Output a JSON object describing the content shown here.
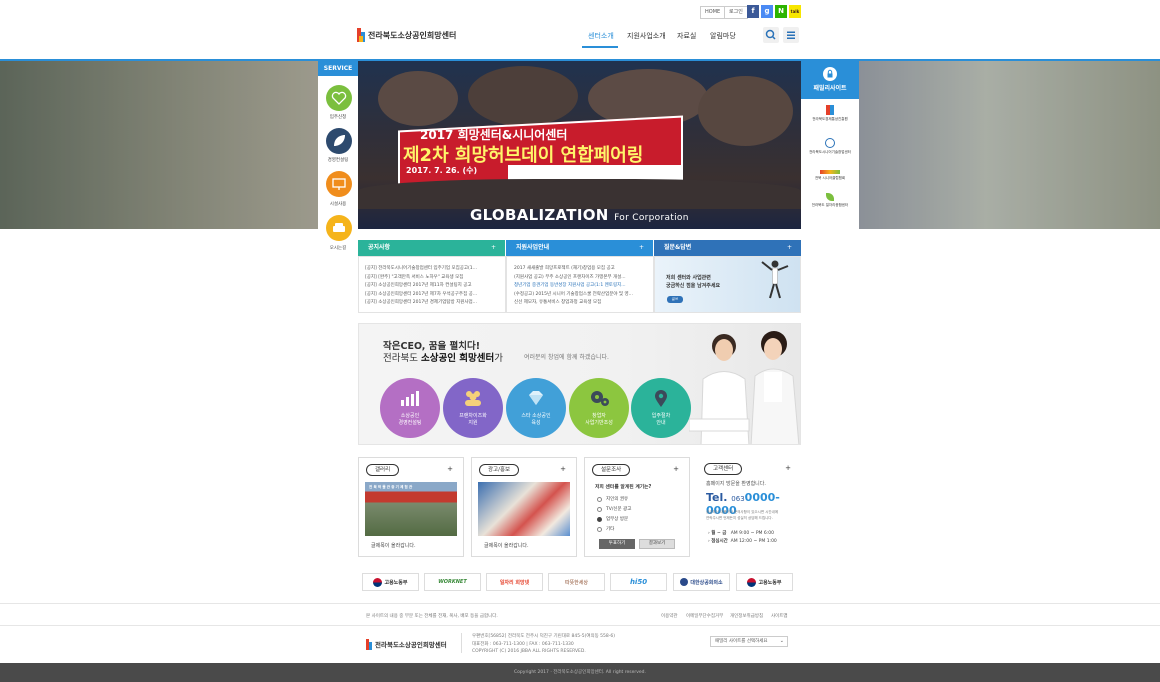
{
  "top_utility": {
    "home": "HOME",
    "login": "로그인",
    "sns": [
      "f",
      "g",
      "N",
      "talk"
    ]
  },
  "header": {
    "logo_text": "전라북도소상공인희망센터",
    "nav": [
      "센터소개",
      "지원사업소개",
      "자료실",
      "알림마당"
    ]
  },
  "hero": {
    "banner_line1": "2017 희망센터&시니어센터",
    "banner_line2": "제2차 희망허브데이 연합페어링",
    "banner_date": "2017. 7. 26. (수)",
    "slogan_main": "GLOBALIZATION",
    "slogan_sub": "For Corporation"
  },
  "service": {
    "title": "SERVICE",
    "items": [
      {
        "label": "입주신청",
        "color": "#7bbf3e"
      },
      {
        "label": "경영컨설팅",
        "color": "#2d4a6e"
      },
      {
        "label": "시설사용",
        "color": "#f08d1c"
      },
      {
        "label": "오시는길",
        "color": "#f5b41b"
      }
    ]
  },
  "family": {
    "title": "패밀리사이트",
    "sites": [
      "전라북도경제통상진흥원",
      "전라북도시니어기술창업센터",
      "전북 시니어클럽협회",
      "전라북도 일자리종합센터"
    ]
  },
  "boards": [
    {
      "title": "공지사항",
      "plus": "+",
      "color": "#2bb39a",
      "items": [
        "[공지] 전라북도시니어기술창업센터 입주기업 모집공고(1...",
        "[공지] [완주] \"고객만족 서비스 노하우\" 교육생 모집",
        "[공지] 소상공인희망센터 2017년 제11차 컨설팅지 공고",
        "[공지] 소상공인희망센터 2017년 제7차 우석공구주집 공...",
        "[공지] 소상공인희망센터 2017년 경제기업탐방 지원사업..."
      ]
    },
    {
      "title": "지원사업안내",
      "plus": "+",
      "color": "#2a8fd8",
      "items": [
        "2017 새새출발 희망프로젝트 (재기)창업용 모집 공고",
        "(지원사업 공고) 무주 소상공인 프랜차이즈 가맹본부 개설...",
        "청년기업 중견기업 동반성장 지원사업 공고(1:1 멘토링지...",
        "(수정공고) 2015년 시니어 기술창업스쿨 전략산업분야 및 영...",
        "신선 제모자, 유통서비스 창업과정 교육생 모집"
      ]
    },
    {
      "title": "질문&답변",
      "plus": "+",
      "color": "#2f72b8",
      "promo_line1": "저희 센터와 사업관련",
      "promo_line2": "궁금하신 점을 남겨주세요",
      "promo_button": "글쓰"
    }
  ],
  "ceo": {
    "line1": "작은CEO, 꿈을 펼치다!",
    "line2_prefix": "전라북도 ",
    "line2_bold": "소상공인 희망센터",
    "line2_suffix": "가",
    "line3": "여러분의 창업에 함께 하겠습니다.",
    "circles": [
      {
        "line1": "소상공인",
        "line2": "경영컨설팅",
        "color": "#b46fc4"
      },
      {
        "line1": "프랜차이즈화",
        "line2": "지원",
        "color": "#8266c8"
      },
      {
        "line1": "스타 소상공인",
        "line2": "육성",
        "color": "#41a0d8"
      },
      {
        "line1": "창업자",
        "line2": "사업기반조성",
        "color": "#8cc63f"
      },
      {
        "line1": "입주절차",
        "line2": "안내",
        "color": "#2bb39a"
      }
    ]
  },
  "widgets": {
    "gallery": {
      "title": "갤러리",
      "plus": "+",
      "caption": "글제목이 올라갑니다.",
      "photo_sign": "전 북 박 물 관   중 기 체 험 관"
    },
    "ad": {
      "title": "광고/홍보",
      "plus": "+",
      "caption": "글제목이 올라갑니다."
    },
    "survey": {
      "title": "설문조사",
      "plus": "+",
      "question": "저희 센터를 알게된 계기는?",
      "options": [
        "지인의 권유",
        "TV/신문 광고",
        "업무상 방문",
        "기타"
      ],
      "selected_index": 2,
      "vote_button": "투표하기",
      "result_button": "결과보기"
    },
    "customer": {
      "title": "고객센터",
      "plus": "+",
      "greeting": "홈페이지 방문을 환영합니다.",
      "tel_label": "Tel.",
      "tel_area": "063",
      "tel_number": "0000-0000",
      "note_line1": "궁금하신 내용이나 문의사항이 있으시면 시간내에",
      "note_line2": "연락주시면 언제든지 성실히 상담해 드립니다.",
      "hours": [
        {
          "label": "월 ~ 금",
          "time": "AM 9:00 ~ PM 6:00"
        },
        {
          "label": "점심시간",
          "time": "AM 12:00 ~ PM 1:00"
        }
      ]
    }
  },
  "partners": [
    "고용노동부",
    "WORKNET",
    "일자리 희망넷",
    "따뜻한세상",
    "hi50",
    "대한상공회의소",
    "고용노동부"
  ],
  "footer": {
    "copy_notice": "본 사이트의 내용 중 부분 또는 전체를 전재, 복사, 배포 등을 금합니다.",
    "links": [
      "이용약관",
      "이메일무단수집거부",
      "개인정보취급방침",
      "사이트맵"
    ],
    "logo_text": "전라북도소상공인희망센터",
    "address": "우편번호[56852] 전라북도 전주시 덕진구 기린대로 845-5(여의동 558-6)",
    "tel_fax": "대표전화 : 063-711-1300    |    FAX : 063-711-1330",
    "copyright_small": "COPYRIGHT (C) 2016 JBBA ALL RIGHTS RESERVED.",
    "family_select": "패밀리 사이트를 선택하세요",
    "bottom_copyright": "Copyright 2017 · 전라북도소상공인희망센터. All right reserved."
  }
}
